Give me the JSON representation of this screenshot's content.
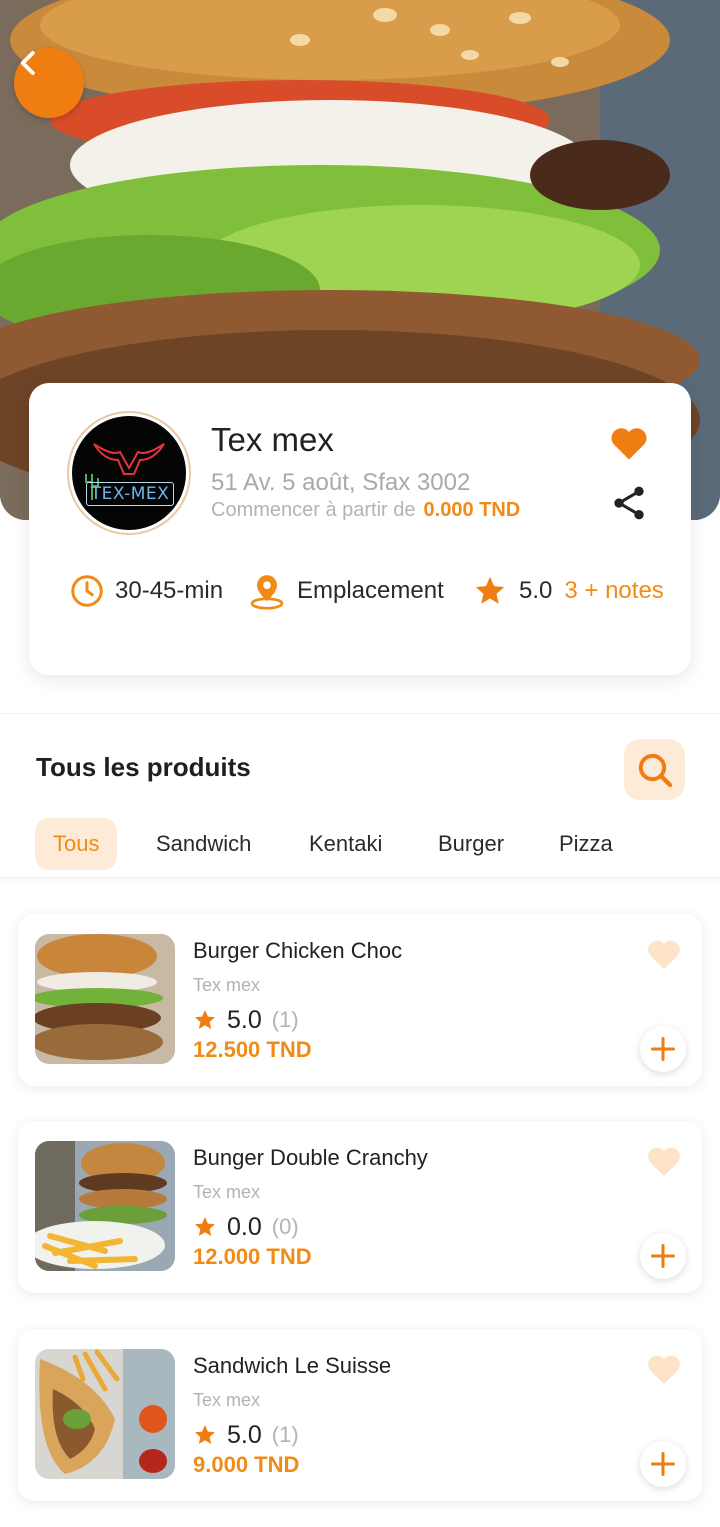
{
  "colors": {
    "accent": "#f08c16",
    "accent_light": "#fdebd8",
    "heart_light": "#fde3c8"
  },
  "hero": {
    "back_icon": "chevron-left-icon"
  },
  "restaurant": {
    "name": "Tex mex",
    "logo_text": "TEX-MEX",
    "address": "51 Av. 5 août, Sfax 3002",
    "start_label": "Commencer à partir de",
    "start_price": "0.000 TND",
    "delivery_time": "30-45-min",
    "location_label": "Emplacement",
    "rating": "5.0",
    "notes_label": "3 + notes"
  },
  "products_section": {
    "title": "Tous les produits",
    "tabs": [
      {
        "label": "Tous",
        "active": true
      },
      {
        "label": "Sandwich",
        "active": false
      },
      {
        "label": "Kentaki",
        "active": false
      },
      {
        "label": "Burger",
        "active": false
      },
      {
        "label": "Pizza",
        "active": false
      }
    ]
  },
  "products": [
    {
      "name": "Burger Chicken Choc",
      "shop": "Tex mex",
      "rating": "5.0",
      "count": "(1)",
      "price": "12.500 TND"
    },
    {
      "name": "Bunger Double Cranchy",
      "shop": "Tex mex",
      "rating": "0.0",
      "count": "(0)",
      "price": "12.000 TND"
    },
    {
      "name": "Sandwich Le Suisse",
      "shop": "Tex mex",
      "rating": "5.0",
      "count": "(1)",
      "price": "9.000 TND"
    }
  ]
}
